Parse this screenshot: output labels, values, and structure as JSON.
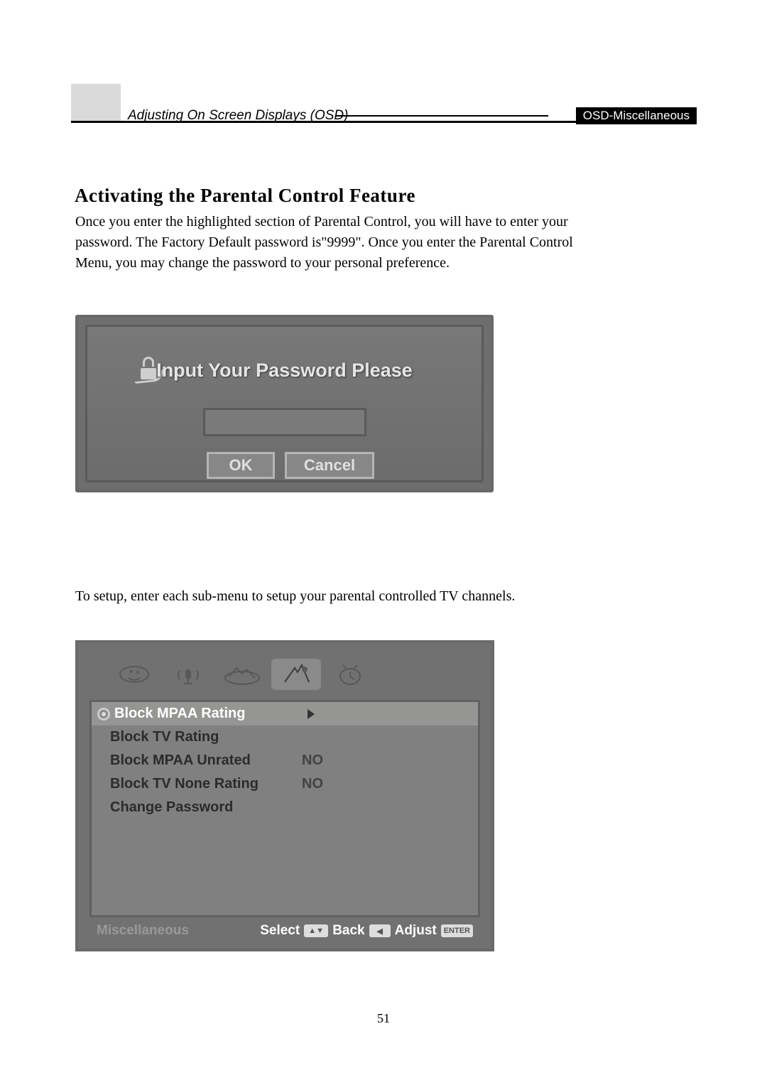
{
  "header": {
    "left_text": "Adjusting On Screen Displays (OSD)",
    "right_chip": "OSD-Miscellaneous"
  },
  "title": "Activating the Parental Control Feature",
  "paragraph1": "Once you enter the highlighted section of Parental Control, you will have to enter your password. The Factory Default password is\"9999\". Once you enter the Parental Control Menu, you may change the password to your personal preference.",
  "osd1": {
    "title": "Input Your Password Please",
    "ok_label": "OK",
    "cancel_label": "Cancel"
  },
  "paragraph2": "To setup, enter each sub-menu to setup your parental controlled TV channels.",
  "osd2": {
    "rows": [
      {
        "label": "Block MPAA Rating",
        "value": "",
        "has_arrow": true,
        "selected": true
      },
      {
        "label": "Block TV Rating",
        "value": "",
        "has_arrow": false,
        "selected": false
      },
      {
        "label": "Block MPAA Unrated",
        "value": "NO",
        "has_arrow": false,
        "selected": false
      },
      {
        "label": "Block TV None Rating",
        "value": "NO",
        "has_arrow": false,
        "selected": false
      },
      {
        "label": "Change Password",
        "value": "",
        "has_arrow": false,
        "selected": false
      }
    ],
    "footer_left": "Miscellaneous",
    "footer_select": "Select",
    "footer_back": "Back",
    "footer_adjust": "Adjust",
    "key_arrows": "▲▼",
    "key_left": "◀",
    "key_enter": "ENTER"
  },
  "page_number": "51"
}
